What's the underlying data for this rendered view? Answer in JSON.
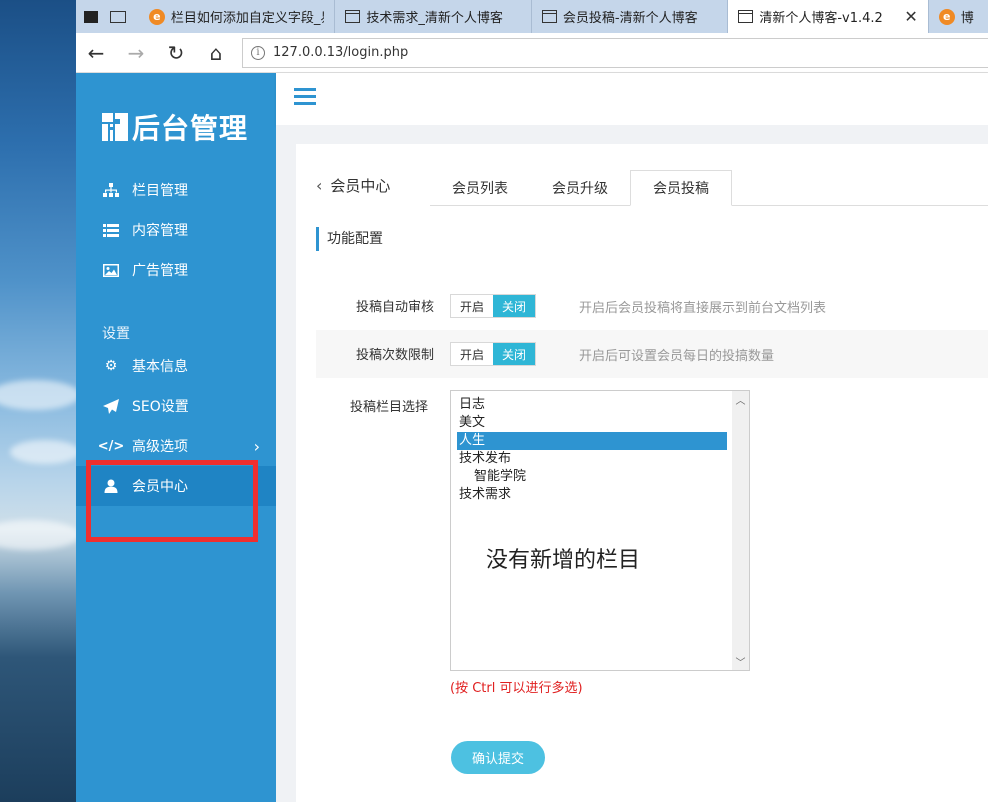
{
  "browser": {
    "tabs": [
      {
        "label": "栏目如何添加自定义字段_易",
        "icon": "edge-e-icon"
      },
      {
        "label": "技术需求_清新个人博客",
        "icon": "page-icon"
      },
      {
        "label": "会员投稿-清新个人博客",
        "icon": "page-icon"
      },
      {
        "label": "清新个人博客-v1.4.2",
        "icon": "page-icon",
        "active": true
      },
      {
        "label": "博",
        "icon": "edge-e-icon"
      }
    ],
    "close_glyph": "✕",
    "url": "127.0.0.13/login.php"
  },
  "sidebar": {
    "logo_text": "后台管理",
    "items_top": [
      {
        "label": "栏目管理",
        "icon": "sitemap-icon"
      },
      {
        "label": "内容管理",
        "icon": "list-icon"
      },
      {
        "label": "广告管理",
        "icon": "image-icon"
      }
    ],
    "section_label": "设置",
    "items_settings": [
      {
        "label": "基本信息",
        "icon": "gear-icon"
      },
      {
        "label": "SEO设置",
        "icon": "paper-plane-icon"
      },
      {
        "label": "高级选项",
        "icon": "code-icon"
      },
      {
        "label": "会员中心",
        "icon": "user-icon",
        "active": true
      }
    ]
  },
  "panel": {
    "title": "会员中心",
    "tabs": [
      {
        "label": "会员列表"
      },
      {
        "label": "会员升级"
      },
      {
        "label": "会员投稿",
        "active": true
      }
    ],
    "section_title": "功能配置",
    "rows": [
      {
        "label": "投稿自动审核",
        "on_label": "开启",
        "off_label": "关闭",
        "hint": "开启后会员投稿将直接展示到前台文档列表"
      },
      {
        "label": "投稿次数限制",
        "on_label": "开启",
        "off_label": "关闭",
        "hint": "开启后可设置会员每日的投搞数量"
      }
    ],
    "select_label": "投稿栏目选择",
    "options": [
      {
        "label": "日志"
      },
      {
        "label": "美文"
      },
      {
        "label": "人生",
        "selected": true
      },
      {
        "label": "技术发布"
      },
      {
        "label": "智能学院",
        "indent": true
      },
      {
        "label": "技术需求"
      }
    ],
    "annotation": "没有新增的栏目",
    "multi_select_note": "(按 Ctrl 可以进行多选)",
    "submit_label": "确认提交"
  },
  "colors": {
    "sidebar": "#2e94d1",
    "switch_active": "#2fb6d6",
    "submit": "#4dc1e1",
    "annotation_box": "#ef2f2f",
    "note": "#e02020"
  }
}
